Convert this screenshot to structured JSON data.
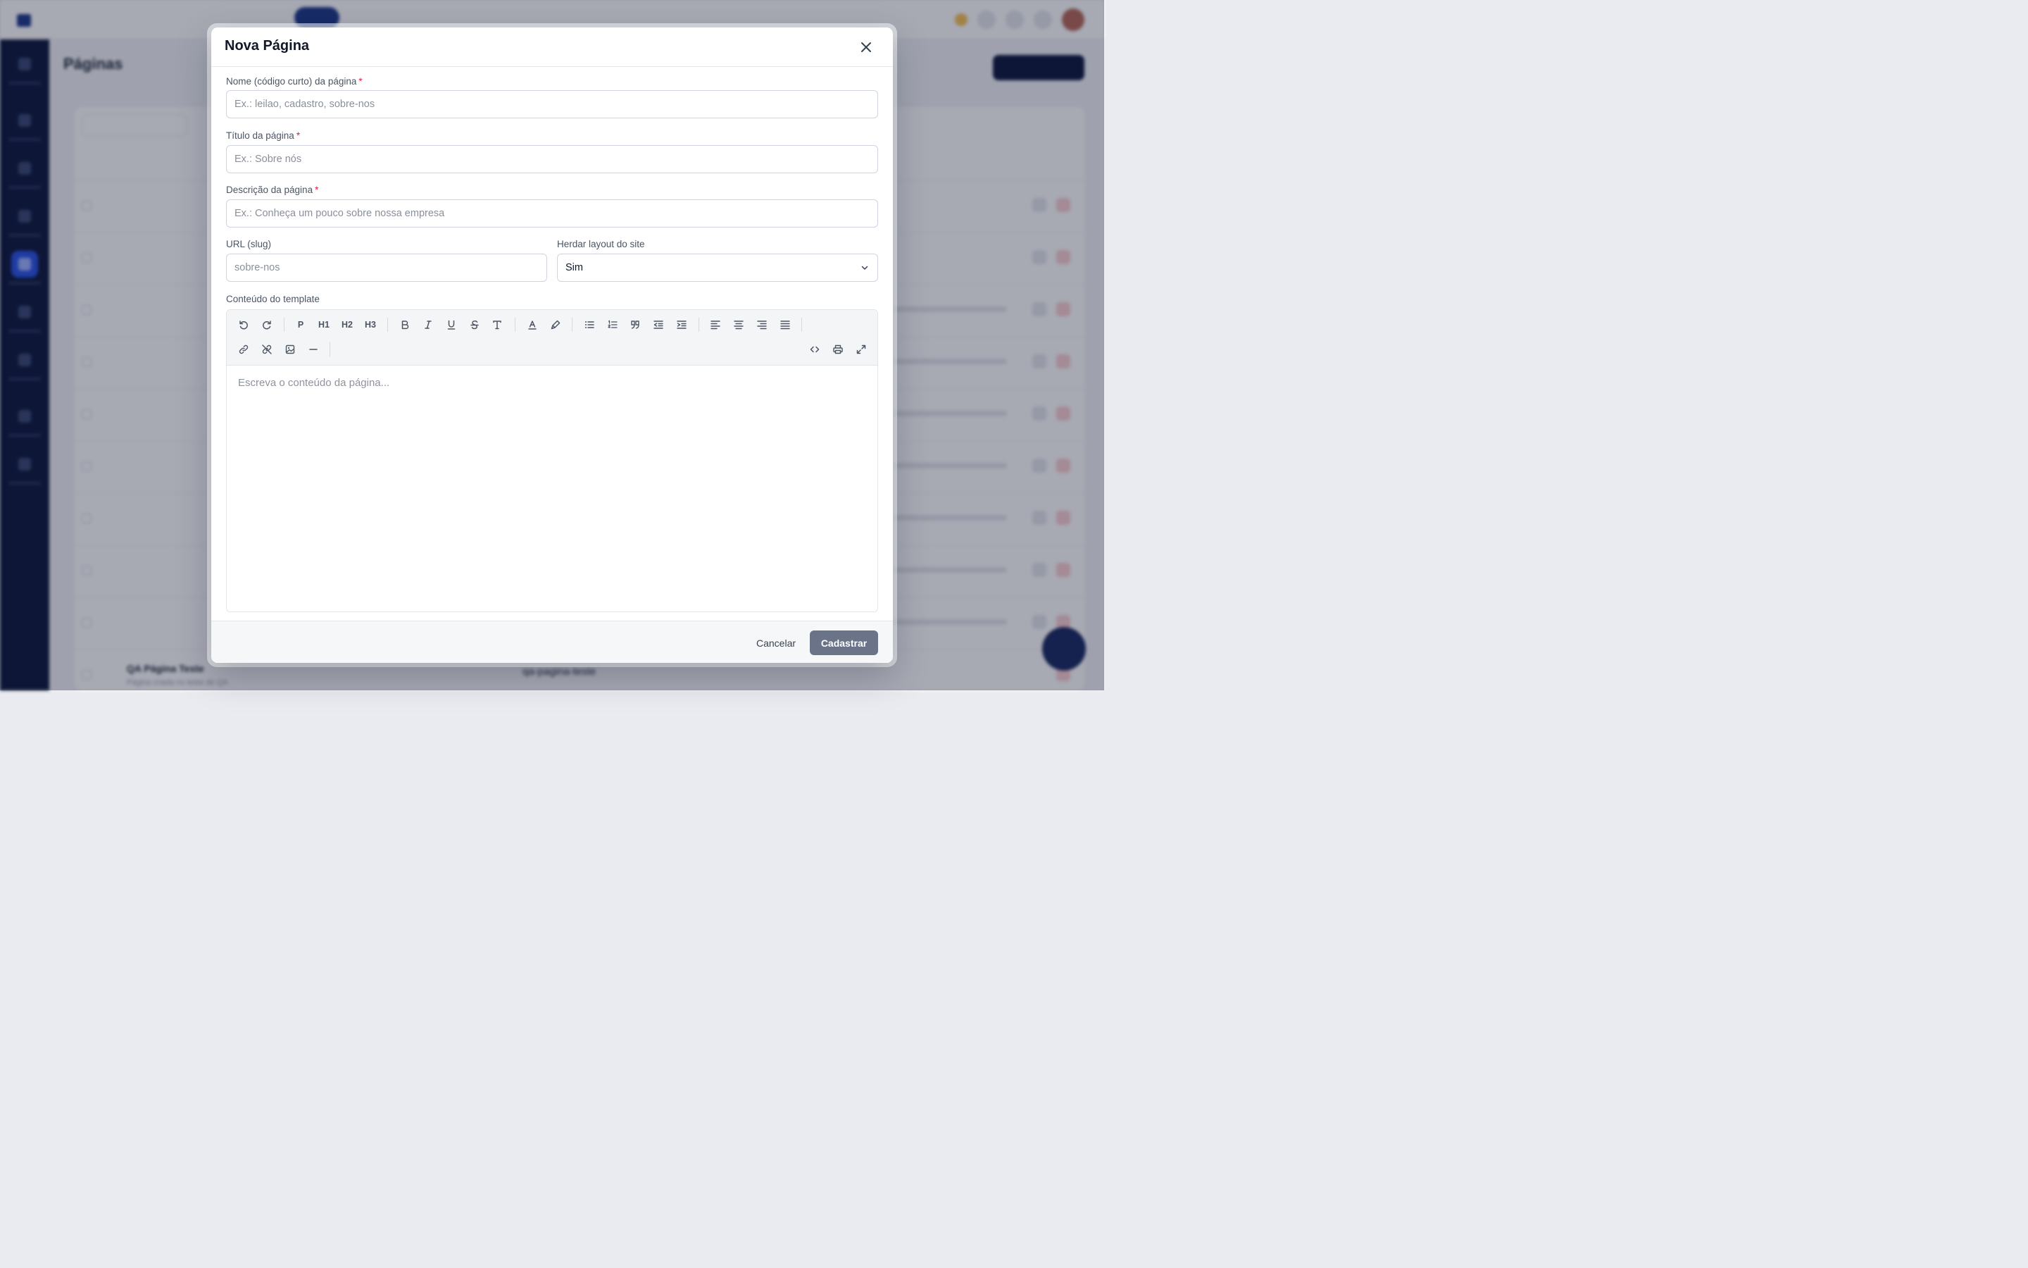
{
  "background": {
    "logo_text": "",
    "topnav": [
      "",
      "",
      "",
      "",
      ""
    ],
    "page_title": "Páginas",
    "table_rows": [
      {
        "title": "",
        "sub": ""
      },
      {
        "title": "",
        "sub": ""
      },
      {
        "title": "",
        "sub": ""
      },
      {
        "title": "",
        "sub": ""
      },
      {
        "title": "",
        "sub": ""
      },
      {
        "title": "",
        "sub": ""
      },
      {
        "title": "",
        "sub": ""
      },
      {
        "title": "",
        "sub": ""
      },
      {
        "title": "",
        "sub": ""
      },
      {
        "title": "QA Página Teste",
        "sub": "Página criada no teste de QA",
        "slug": "qa-pagina-teste"
      }
    ]
  },
  "modal": {
    "title": "Nova Página",
    "required_mark": "*",
    "fields": {
      "name": {
        "label": "Nome (código curto) da página",
        "placeholder": "Ex.: leilao, cadastro, sobre-nos",
        "value": ""
      },
      "title": {
        "label": "Título da página",
        "placeholder": "Ex.: Sobre nós",
        "value": ""
      },
      "description": {
        "label": "Descrição da página",
        "placeholder": "Ex.: Conheça um pouco sobre nossa empresa",
        "value": ""
      },
      "slug": {
        "label": "URL (slug)",
        "placeholder": "sobre-nos",
        "value": ""
      },
      "inherit_layout": {
        "label": "Herdar layout do site",
        "selected": "Sim"
      }
    },
    "editor": {
      "label": "Conteúdo do template",
      "placeholder": "Escreva o conteúdo da página...",
      "toolbar": {
        "p": "P",
        "h1": "H1",
        "h2": "H2",
        "h3": "H3"
      }
    },
    "footer": {
      "cancel": "Cancelar",
      "submit": "Cadastrar"
    }
  },
  "colors": {
    "primary_dark": "#0f1a3d",
    "submit_button": "#6b7389",
    "required": "#e11d48"
  }
}
